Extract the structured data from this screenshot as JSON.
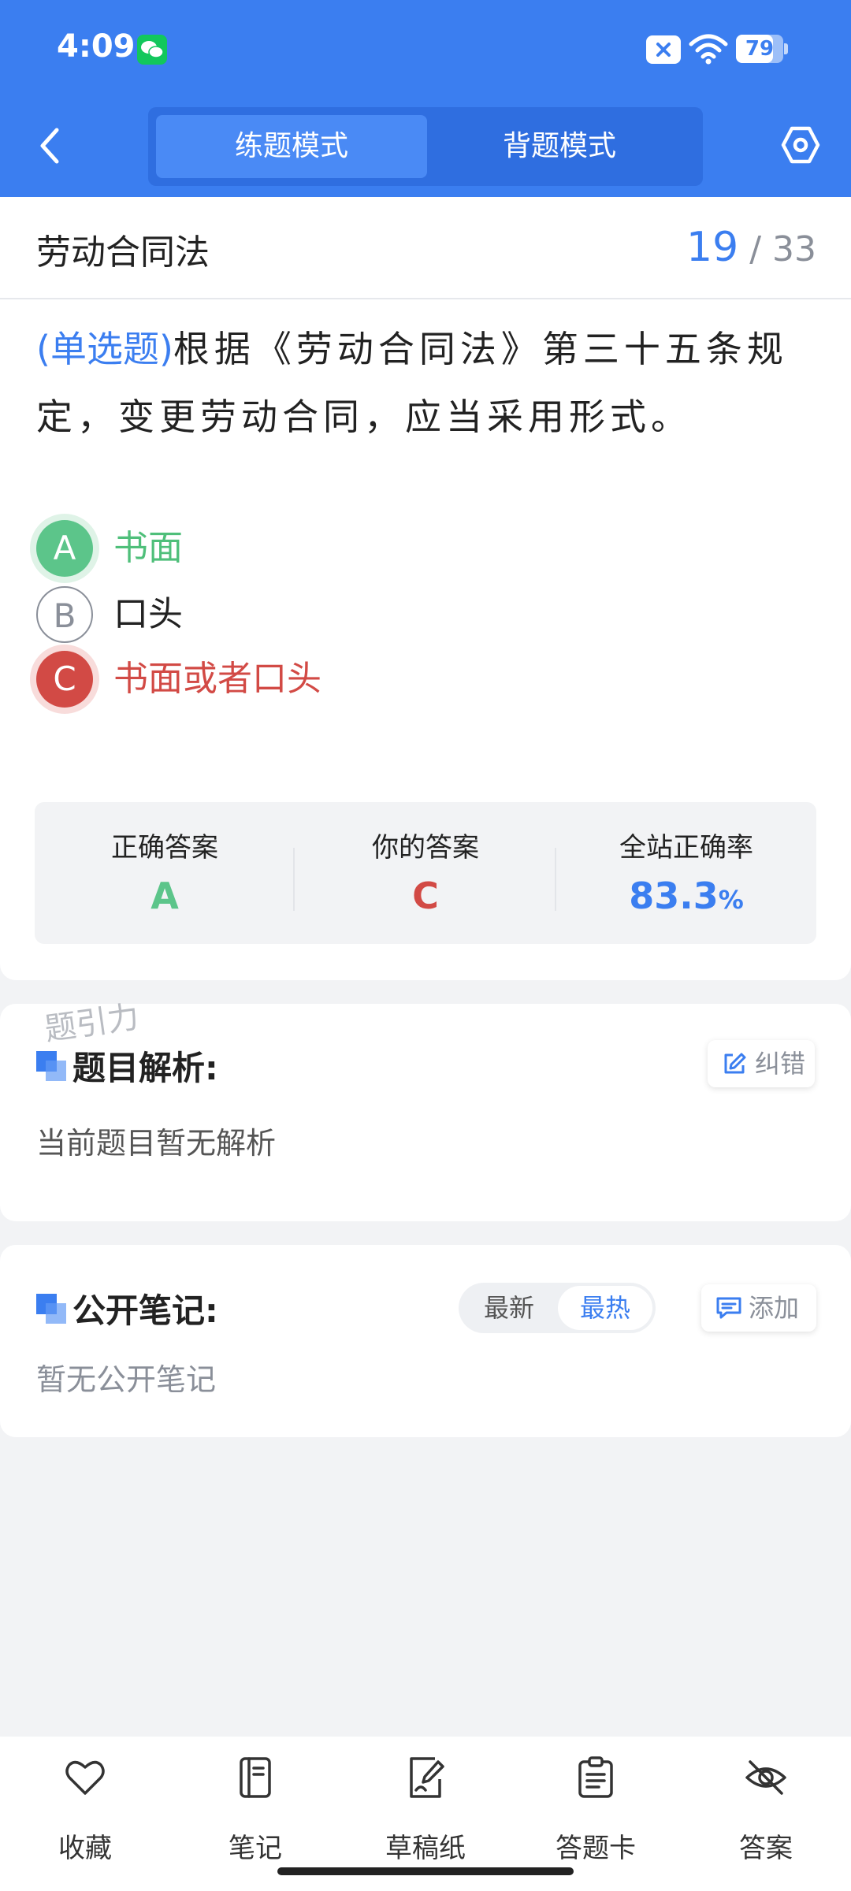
{
  "status_bar": {
    "time": "4:09",
    "battery": "79",
    "battery_level": 0.79
  },
  "header": {
    "tabs": [
      {
        "label": "练题模式",
        "active": true
      },
      {
        "label": "背题模式",
        "active": false
      }
    ],
    "accent_color": "#3b7ef0"
  },
  "question": {
    "subject": "劳动合同法",
    "current": "19",
    "total": "/ 33",
    "type_label": "(单选题)",
    "text": "根据《劳动合同法》第三十五条规定，变更劳动合同，应当采用形式。",
    "options": [
      {
        "letter": "A",
        "text": "书面",
        "state": "correct",
        "color": "#5cc58a"
      },
      {
        "letter": "B",
        "text": "口头",
        "state": "neutral"
      },
      {
        "letter": "C",
        "text": "书面或者口头",
        "state": "wrong",
        "color": "#d24a45"
      }
    ]
  },
  "stats": {
    "correct_label": "正确答案",
    "correct_value": "A",
    "yours_label": "你的答案",
    "yours_value": "C",
    "rate_label": "全站正确率",
    "rate_value": "83.3",
    "rate_unit": "%"
  },
  "analysis": {
    "watermark": "题引力",
    "title": "题目解析:",
    "report_label": "纠错",
    "empty_text": "当前题目暂无解析"
  },
  "notes": {
    "title": "公开笔记:",
    "sort_latest": "最新",
    "sort_hot": "最热",
    "add_label": "添加",
    "empty_text": "暂无公开笔记"
  },
  "bottom_nav": {
    "items": [
      {
        "label": "收藏",
        "icon": "heart-icon"
      },
      {
        "label": "笔记",
        "icon": "notebook-icon"
      },
      {
        "label": "草稿纸",
        "icon": "draft-paper-icon"
      },
      {
        "label": "答题卡",
        "icon": "answer-card-icon"
      },
      {
        "label": "答案",
        "icon": "eye-off-icon"
      }
    ]
  }
}
